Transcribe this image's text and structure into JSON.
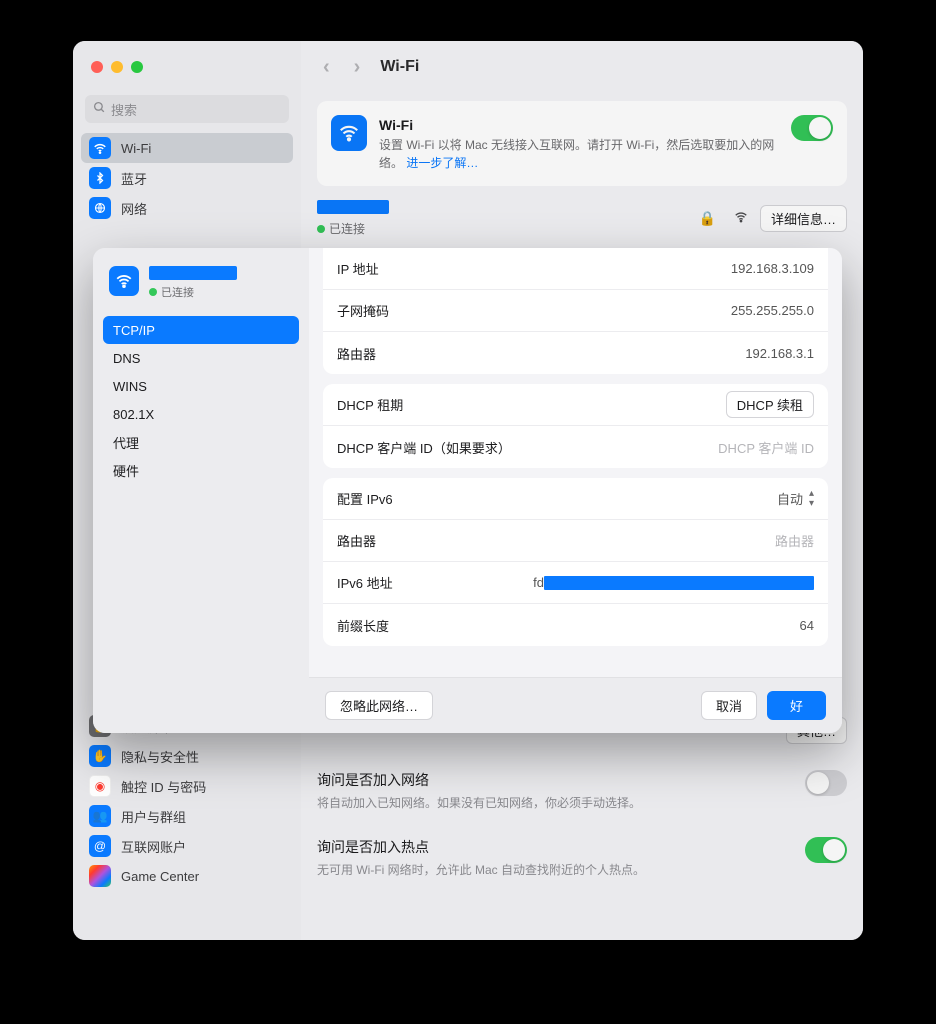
{
  "window": {
    "title": "Wi-Fi"
  },
  "search": {
    "placeholder": "搜索"
  },
  "sidebar": {
    "items": [
      {
        "label": "Wi-Fi",
        "color": "#0a7aff"
      },
      {
        "label": "蓝牙",
        "color": "#0a7aff"
      },
      {
        "label": "网络",
        "color": "#0a7aff"
      }
    ],
    "lower": [
      {
        "label": "锁定屏幕",
        "color": "#6d6d70"
      },
      {
        "label": "隐私与安全性",
        "color": "#0a7aff"
      },
      {
        "label": "触控 ID 与密码",
        "color": "#ff3b30"
      },
      {
        "label": "用户与群组",
        "color": "#0a7aff"
      },
      {
        "label": "互联网账户",
        "color": "#0a7aff"
      },
      {
        "label": "Game Center",
        "color": "#7cca5f"
      }
    ]
  },
  "wifi_card": {
    "title": "Wi-Fi",
    "desc_a": "设置 Wi-Fi 以将 Mac 无线接入互联网。请打开 Wi-Fi，然后选取要加入的网络。",
    "learn_more": "进一步了解…"
  },
  "connection": {
    "status": "已连接",
    "details_btn": "详细信息…",
    "other_btn": "其他…"
  },
  "ask_join": {
    "title": "询问是否加入网络",
    "desc": "将自动加入已知网络。如果没有已知网络，你必须手动选择。"
  },
  "ask_hotspot": {
    "title": "询问是否加入热点",
    "desc": "无可用 Wi-Fi 网络时，允许此 Mac 自动查找附近的个人热点。"
  },
  "sheet": {
    "connected": "已连接",
    "tabs": [
      "TCP/IP",
      "DNS",
      "WINS",
      "802.1X",
      "代理",
      "硬件"
    ],
    "rows": {
      "ip_label": "IP 地址",
      "ip_value": "192.168.3.109",
      "subnet_label": "子网掩码",
      "subnet_value": "255.255.255.0",
      "router_label": "路由器",
      "router_value": "192.168.3.1",
      "dhcp_lease_label": "DHCP 租期",
      "dhcp_renew_btn": "DHCP 续租",
      "dhcp_client_label": "DHCP 客户端 ID（如果要求）",
      "dhcp_client_ph": "DHCP 客户端 ID",
      "ipv6_config_label": "配置 IPv6",
      "ipv6_config_value": "自动",
      "router6_label": "路由器",
      "router6_ph": "路由器",
      "ipv6_addr_label": "IPv6 地址",
      "ipv6_addr_prefix": "fd",
      "prefix_len_label": "前缀长度",
      "prefix_len_value": "64"
    },
    "footer": {
      "forget": "忽略此网络…",
      "cancel": "取消",
      "ok": "好"
    }
  }
}
